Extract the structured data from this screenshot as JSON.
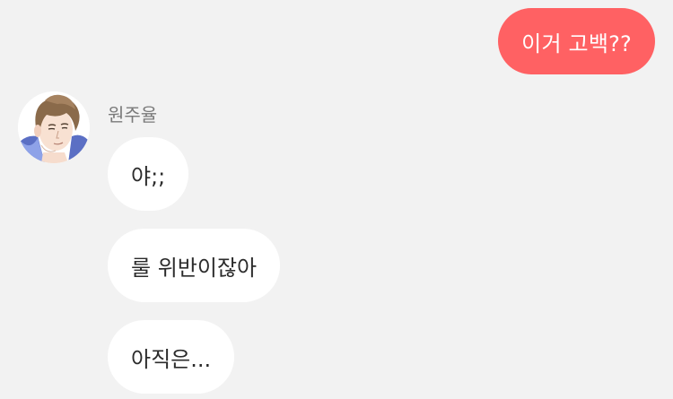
{
  "conversation": {
    "outgoing_messages": [
      {
        "text": "이거 고백??"
      }
    ],
    "contact": {
      "name": "원주율",
      "avatar_icon": "cartoon-boy-avatar-icon"
    },
    "incoming_messages": [
      {
        "text": "야;;"
      },
      {
        "text": "룰 위반이잖아"
      },
      {
        "text": "아직은..."
      }
    ]
  },
  "colors": {
    "background": "#f2f2f2",
    "outgoing_bubble": "#ff6163",
    "incoming_bubble": "#ffffff",
    "sender_name": "#7a7a7a"
  }
}
